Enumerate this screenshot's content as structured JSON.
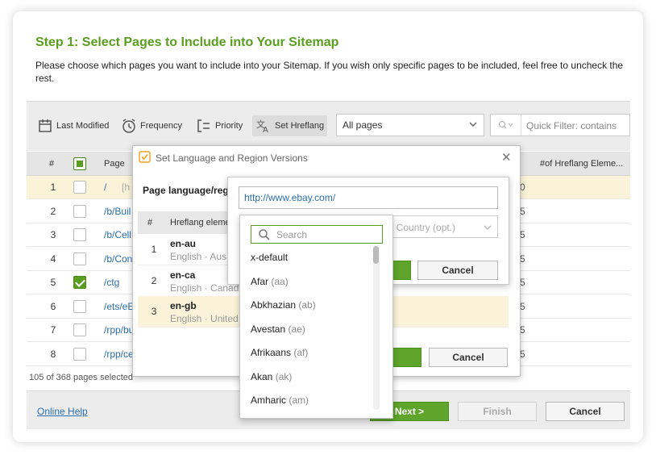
{
  "step": {
    "title": "Step 1: Select Pages to Include into Your Sitemap",
    "description": "Please choose which pages you want to include into your Sitemap. If you wish only specific pages to be included, feel free to uncheck the rest."
  },
  "toolbar": {
    "last_modified": "Last Modified",
    "frequency": "Frequency",
    "priority": "Priority",
    "set_hreflang": "Set Hreflang",
    "filter_select": "All pages",
    "quick_filter_placeholder": "Quick Filter: contains"
  },
  "table": {
    "headers": {
      "num": "#",
      "page": "Page",
      "hreflang_count": "#of Hreflang Eleme..."
    },
    "rows": [
      {
        "num": "1",
        "page": "/",
        "extra": "[h",
        "right": "0",
        "checked": false,
        "highlight": true
      },
      {
        "num": "2",
        "page": "/b/Buil",
        "right": "5",
        "checked": false,
        "highlight": false
      },
      {
        "num": "3",
        "page": "/b/Cell",
        "right": "5",
        "checked": false,
        "highlight": false
      },
      {
        "num": "4",
        "page": "/b/Con",
        "right": "5",
        "checked": false,
        "highlight": false
      },
      {
        "num": "5",
        "page": "/ctg",
        "right": "5",
        "checked": true,
        "highlight": false
      },
      {
        "num": "6",
        "page": "/ets/eE",
        "right": "5",
        "checked": false,
        "highlight": false
      },
      {
        "num": "7",
        "page": "/rpp/bu",
        "right": "5",
        "checked": false,
        "highlight": false
      },
      {
        "num": "8",
        "page": "/rpp/ce",
        "right": "5",
        "checked": false,
        "highlight": false
      }
    ],
    "selected_count": "105 of 368 pages selected"
  },
  "footer": {
    "online_help": "Online Help",
    "next": "Next >",
    "finish": "Finish",
    "cancel": "Cancel"
  },
  "dialog_lang": {
    "title": "Set Language and Region Versions",
    "page_language_label": "Page language/regi",
    "headers": {
      "num": "#",
      "hreflang": "Hreflang eleme"
    },
    "rows": [
      {
        "num": "1",
        "code": "en-au",
        "sub": "English · Aus"
      },
      {
        "num": "2",
        "code": "en-ca",
        "sub": "English · Canad"
      },
      {
        "num": "3",
        "code": "en-gb",
        "sub": "English · United"
      }
    ],
    "cancel": "Cancel"
  },
  "dialog_url": {
    "url": "http://www.ebay.com/",
    "country_placeholder": "Select Country (opt.)",
    "cancel": "Cancel"
  },
  "language_dropdown": {
    "search_placeholder": "Search",
    "items": [
      {
        "name": "x-default",
        "code": ""
      },
      {
        "name": "Afar",
        "code": "(aa)"
      },
      {
        "name": "Abkhazian",
        "code": "(ab)"
      },
      {
        "name": "Avestan",
        "code": "(ae)"
      },
      {
        "name": "Afrikaans",
        "code": "(af)"
      },
      {
        "name": "Akan",
        "code": "(ak)"
      },
      {
        "name": "Amharic",
        "code": "(am)"
      }
    ]
  },
  "colors": {
    "accent_green": "#5a9e1f",
    "link_blue": "#2a6fb0",
    "highlight_row": "#fbf3d9"
  }
}
